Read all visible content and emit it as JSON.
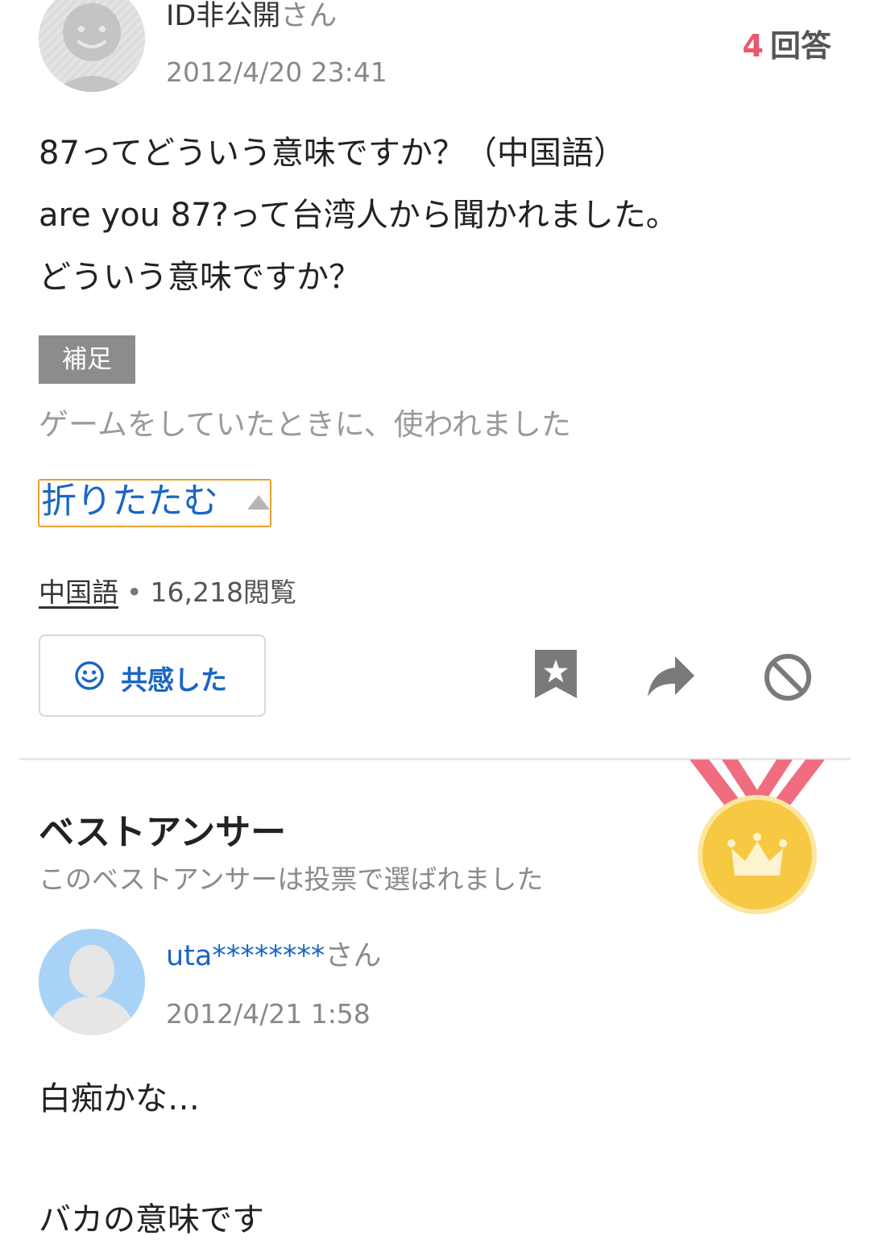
{
  "question": {
    "user_name": "ID非公開",
    "user_suffix": "さん",
    "date": "2012/4/20 23:41",
    "answer_count": "4",
    "answer_label": "回答",
    "body_lines": [
      "87ってどういう意味ですか？（中国語）",
      "are you 87?って台湾人から聞かれました。",
      "どういう意味ですか？"
    ],
    "supplement_label": "補足",
    "supplement_text": "ゲームをしていたときに、使われました",
    "fold_label": "折りたたむ",
    "category": "中国語",
    "views": "16,218閲覧",
    "empathy_label": "共感した"
  },
  "best_answer": {
    "title": "ベストアンサー",
    "subtitle": "このベストアンサーは投票で選ばれました",
    "user_name": "uta********",
    "user_suffix": "さん",
    "date": "2012/4/21 1:58",
    "body_lines": [
      "白痴かな…",
      "バカの意味です"
    ]
  },
  "icons": {
    "empathy": "smiley-icon",
    "bookmark": "bookmark-star-icon",
    "share": "share-arrow-icon",
    "block": "block-icon",
    "medal": "crown-medal-icon",
    "fold": "caret-up-icon"
  },
  "colors": {
    "accent_blue": "#1a66c4",
    "answer_count": "#e75a6e",
    "fold_border": "#e4a12d",
    "medal_gold": "#f7c841",
    "ribbon": "#f06d80"
  }
}
